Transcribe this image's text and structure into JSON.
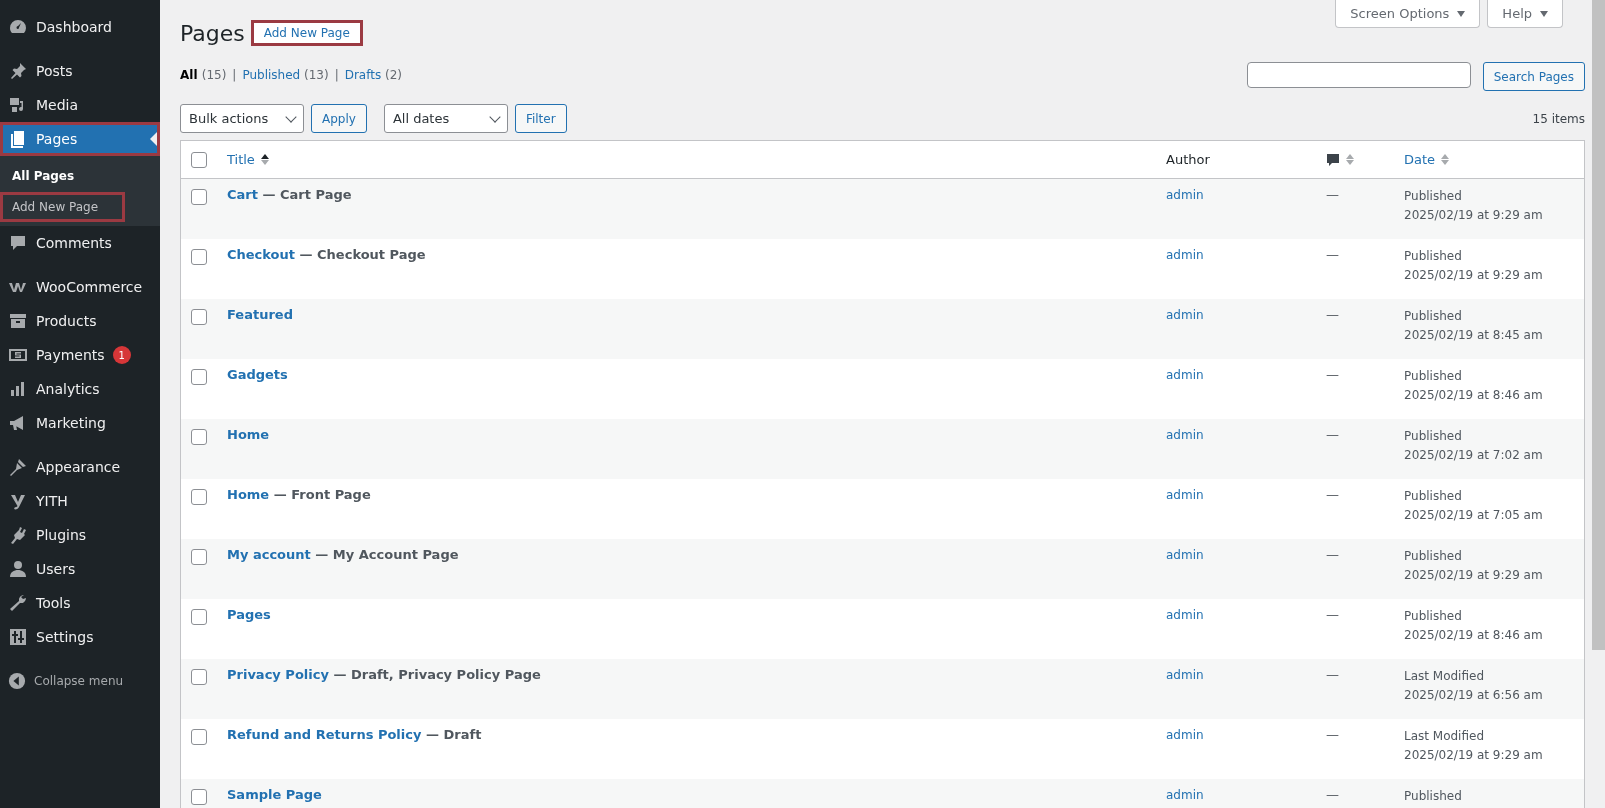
{
  "sidebar": {
    "groups": [
      [
        {
          "label": "Dashboard",
          "selected": false,
          "highlighted": false
        }
      ],
      [
        {
          "label": "Posts",
          "selected": false,
          "highlighted": false
        },
        {
          "label": "Media",
          "selected": false,
          "highlighted": false
        },
        {
          "label": "Pages",
          "selected": true,
          "highlighted": true,
          "children": [
            {
              "label": "All Pages",
              "selected": true,
              "highlighted": false
            },
            {
              "label": "Add New Page",
              "selected": false,
              "highlighted": true
            }
          ]
        },
        {
          "label": "Comments",
          "selected": false,
          "highlighted": false
        }
      ],
      [
        {
          "label": "WooCommerce",
          "selected": false,
          "highlighted": false
        },
        {
          "label": "Products",
          "selected": false,
          "highlighted": false
        },
        {
          "label": "Payments",
          "selected": false,
          "highlighted": false,
          "badge": "1"
        },
        {
          "label": "Analytics",
          "selected": false,
          "highlighted": false
        },
        {
          "label": "Marketing",
          "selected": false,
          "highlighted": false
        }
      ],
      [
        {
          "label": "Appearance",
          "selected": false,
          "highlighted": false
        },
        {
          "label": "YITH",
          "selected": false,
          "highlighted": false
        },
        {
          "label": "Plugins",
          "selected": false,
          "highlighted": false
        },
        {
          "label": "Users",
          "selected": false,
          "highlighted": false
        },
        {
          "label": "Tools",
          "selected": false,
          "highlighted": false
        },
        {
          "label": "Settings",
          "selected": false,
          "highlighted": false
        }
      ]
    ],
    "collapse": "Collapse menu"
  },
  "top_buttons": [
    "Screen Options",
    "Help"
  ],
  "heading": {
    "title": "Pages",
    "add_button": "Add New Page",
    "add_highlighted": true
  },
  "filter_separator": "|",
  "filters": [
    {
      "label": "All",
      "count": "(15)",
      "selected": true
    },
    {
      "label": "Published",
      "count": "(13)",
      "selected": false
    },
    {
      "label": "Drafts",
      "count": "(2)",
      "selected": false
    }
  ],
  "search": {
    "button": "Search Pages"
  },
  "toolbar": {
    "bulk": "Bulk actions",
    "apply": "Apply",
    "dates": "All dates",
    "filter": "Filter",
    "count": "15 items"
  },
  "table": {
    "select_all_checked": false,
    "columns": [
      {
        "label": "Title",
        "sorted": true
      },
      {
        "label": "Author"
      },
      {
        "kind": "comments",
        "sorted": false
      },
      {
        "label": "Date",
        "sorted": false
      }
    ],
    "rows": [
      {
        "checked": false,
        "title": "Cart",
        "state": "— Cart Page",
        "author": "admin",
        "comments": "—",
        "status": "Published",
        "date": "2025/02/19 at 9:29 am"
      },
      {
        "checked": false,
        "title": "Checkout",
        "state": "— Checkout Page",
        "author": "admin",
        "comments": "—",
        "status": "Published",
        "date": "2025/02/19 at 9:29 am"
      },
      {
        "checked": false,
        "title": "Featured",
        "author": "admin",
        "comments": "—",
        "status": "Published",
        "date": "2025/02/19 at 8:45 am"
      },
      {
        "checked": false,
        "title": "Gadgets",
        "author": "admin",
        "comments": "—",
        "status": "Published",
        "date": "2025/02/19 at 8:46 am"
      },
      {
        "checked": false,
        "title": "Home",
        "author": "admin",
        "comments": "—",
        "status": "Published",
        "date": "2025/02/19 at 7:02 am"
      },
      {
        "checked": false,
        "title": "Home",
        "state": "— Front Page",
        "author": "admin",
        "comments": "—",
        "status": "Published",
        "date": "2025/02/19 at 7:05 am"
      },
      {
        "checked": false,
        "title": "My account",
        "state": "— My Account Page",
        "author": "admin",
        "comments": "—",
        "status": "Published",
        "date": "2025/02/19 at 9:29 am"
      },
      {
        "checked": false,
        "title": "Pages",
        "author": "admin",
        "comments": "—",
        "status": "Published",
        "date": "2025/02/19 at 8:46 am"
      },
      {
        "checked": false,
        "title": "Privacy Policy",
        "state": "— Draft, Privacy Policy Page",
        "author": "admin",
        "comments": "—",
        "status": "Last Modified",
        "date": "2025/02/19 at 6:56 am"
      },
      {
        "checked": false,
        "title": "Refund and Returns Policy",
        "state": "— Draft",
        "author": "admin",
        "comments": "—",
        "status": "Last Modified",
        "date": "2025/02/19 at 9:29 am"
      },
      {
        "checked": false,
        "title": "Sample Page",
        "author": "admin",
        "comments": "—",
        "status": "Published"
      }
    ]
  }
}
